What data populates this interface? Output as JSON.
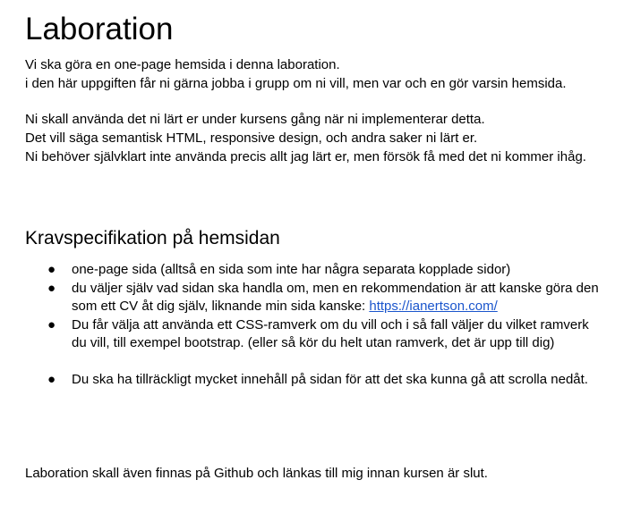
{
  "title": "Laboration",
  "intro": {
    "line1": "Vi ska göra en one-page hemsida i denna laboration.",
    "line2": "i den här uppgiften får ni gärna jobba i grupp om ni vill, men var och en gör varsin hemsida."
  },
  "rules": {
    "line1": "Ni skall använda det ni lärt er under kursens gång när ni implementerar detta.",
    "line2": "Det vill säga semantisk HTML, responsive design, och andra saker ni lärt er.",
    "line3": "Ni behöver självklart inte använda precis allt jag lärt er, men försök få med det ni kommer ihåg."
  },
  "section_heading": "Kravspecifikation på hemsidan",
  "requirements": [
    {
      "text": "one-page sida (alltså en sida som inte har några separata kopplade sidor)"
    },
    {
      "text": "du väljer själv vad sidan ska handla om, men en rekommendation är att kanske göra den som ett CV åt dig själv, liknande min sida kanske: ",
      "link": "https://ianertson.com/"
    },
    {
      "text": "Du får välja att använda ett CSS-ramverk om du vill och i så fall väljer du vilket ramverk du vill, till exempel bootstrap. (eller så kör du helt utan ramverk, det är upp till dig)"
    },
    {
      "text": "Du ska ha tillräckligt mycket innehåll på sidan för att det ska kunna gå att scrolla nedåt."
    }
  ],
  "bullet_symbol": "●",
  "footer": "Laboration skall även finnas på Github och länkas till mig innan kursen är slut.",
  "colors": {
    "text": "#000000",
    "link": "#1a55cc",
    "background": "#ffffff"
  }
}
